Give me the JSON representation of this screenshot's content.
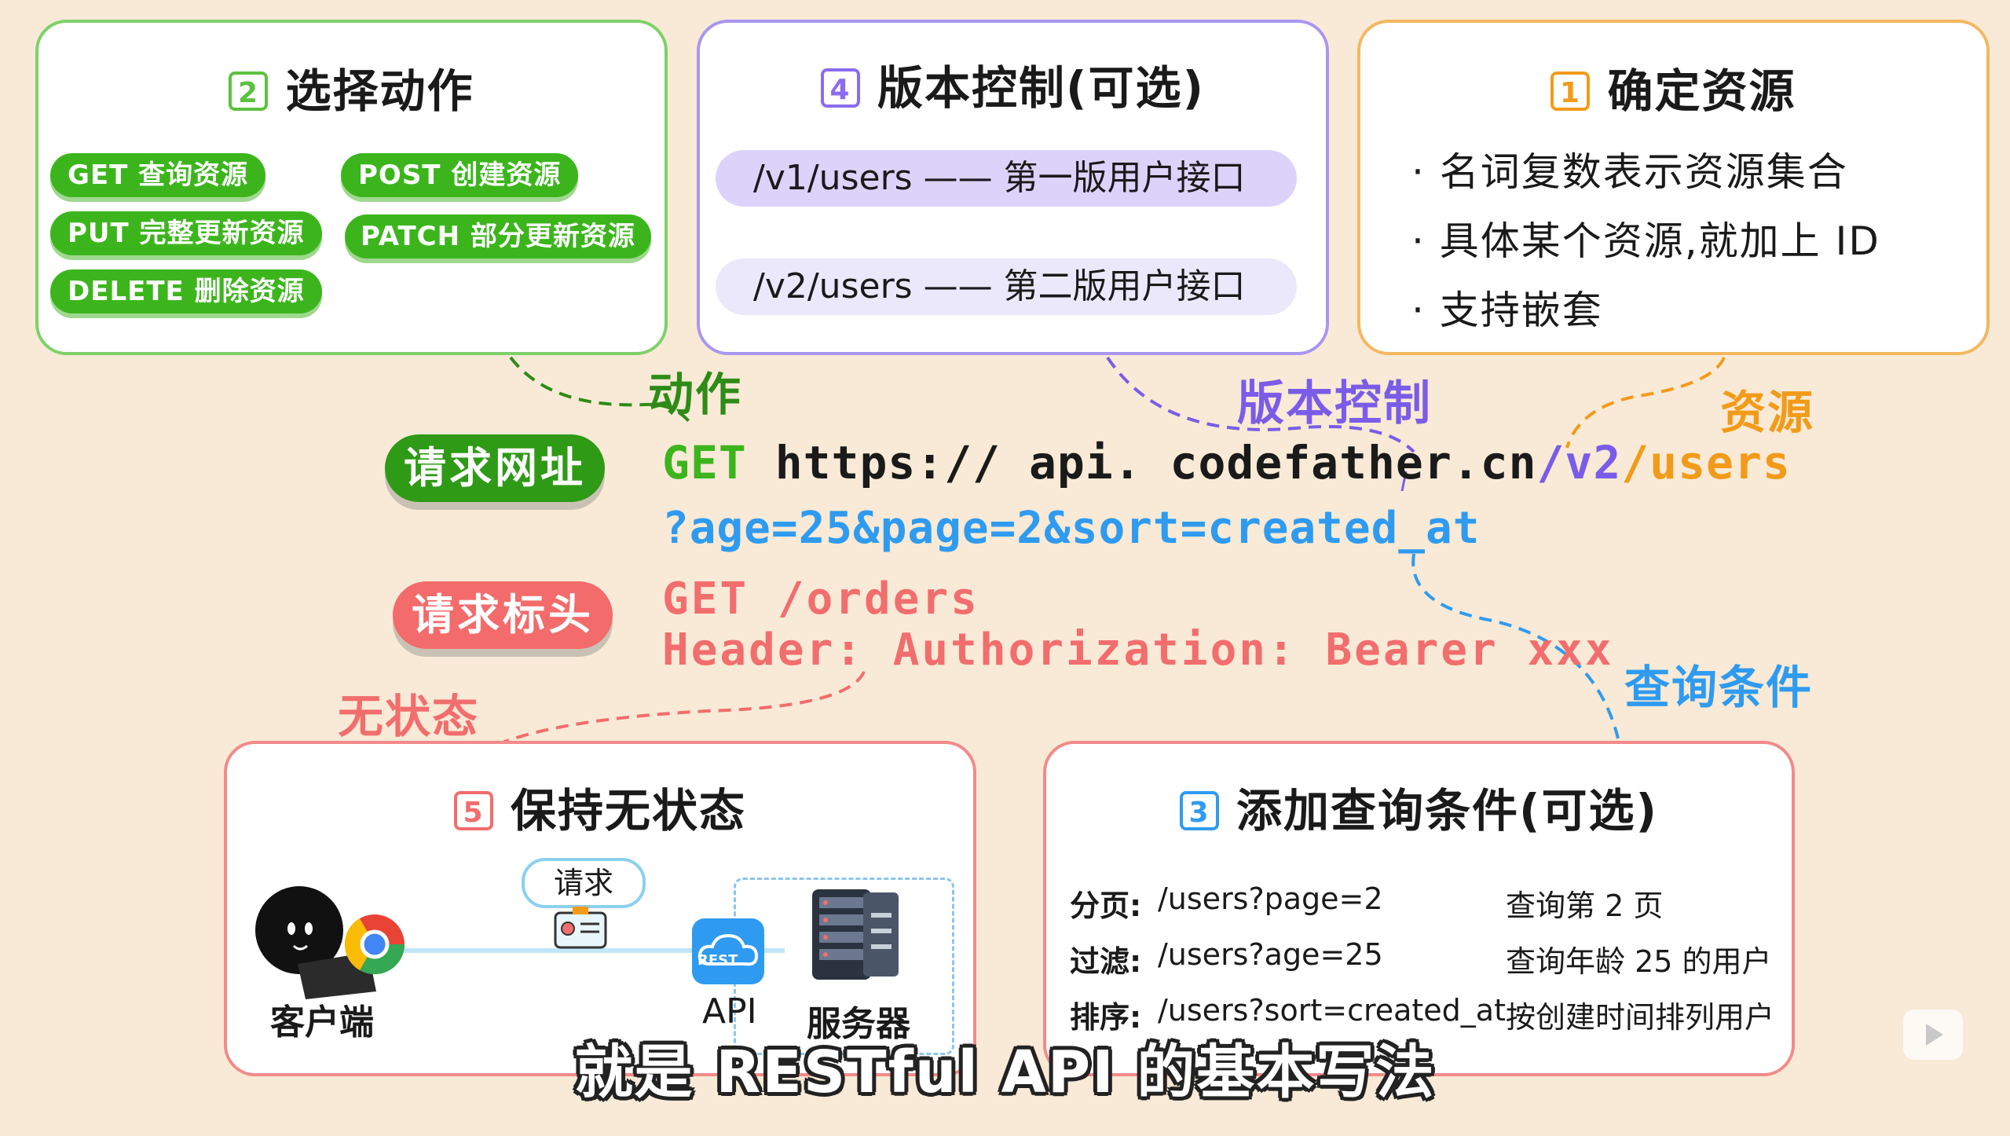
{
  "colors": {
    "background": "#f8ead6",
    "green": "#3cb51d",
    "purple": "#8a6cf0",
    "orange": "#f29b1a",
    "red": "#f26d6d",
    "blue": "#2f9bf0"
  },
  "card_actions": {
    "num": "2",
    "title": "选择动作",
    "pills": [
      "GET 查询资源",
      "POST 创建资源",
      "PUT 完整更新资源",
      "PATCH 部分更新资源",
      "DELETE 删除资源"
    ]
  },
  "card_version": {
    "num": "4",
    "title": "版本控制(可选)",
    "v1": "/v1/users —— 第一版用户接口",
    "v2": "/v2/users —— 第二版用户接口"
  },
  "card_resource": {
    "num": "1",
    "title": "确定资源",
    "bullets": [
      "· 名词复数表示资源集合",
      "· 具体某个资源,就加上 ID",
      "· 支持嵌套"
    ]
  },
  "labels": {
    "action": "动作",
    "version": "版本控制",
    "resource": "资源",
    "stateless": "无状态",
    "query": "查询条件"
  },
  "tags": {
    "url": "请求网址",
    "header": "请求标头"
  },
  "url_line": {
    "method": "GET",
    "host": "https:// api. codefather.cn",
    "slash": "/",
    "version": "v2",
    "path": "/users",
    "query": "?age=25&page=2&sort=created_at"
  },
  "header_block": {
    "line1": "GET /orders",
    "line2": "Header: Authorization: Bearer xxx"
  },
  "card_stateless": {
    "num": "5",
    "title": "保持无状态",
    "request_label": "请求",
    "rest_badge": "REST",
    "client": "客户端",
    "api": "API",
    "server": "服务器"
  },
  "card_query": {
    "num": "3",
    "title": "添加查询条件(可选)",
    "rows": [
      {
        "label": "分页:",
        "example": "/users?page=2",
        "desc": "查询第 2 页"
      },
      {
        "label": "过滤:",
        "example": "/users?age=25",
        "desc": "查询年龄 25 的用户"
      },
      {
        "label": "排序:",
        "example": "/users?sort=created_at",
        "desc": "按创建时间排列用户"
      }
    ]
  },
  "subtitle": "就是 RESTful API 的基本写法"
}
